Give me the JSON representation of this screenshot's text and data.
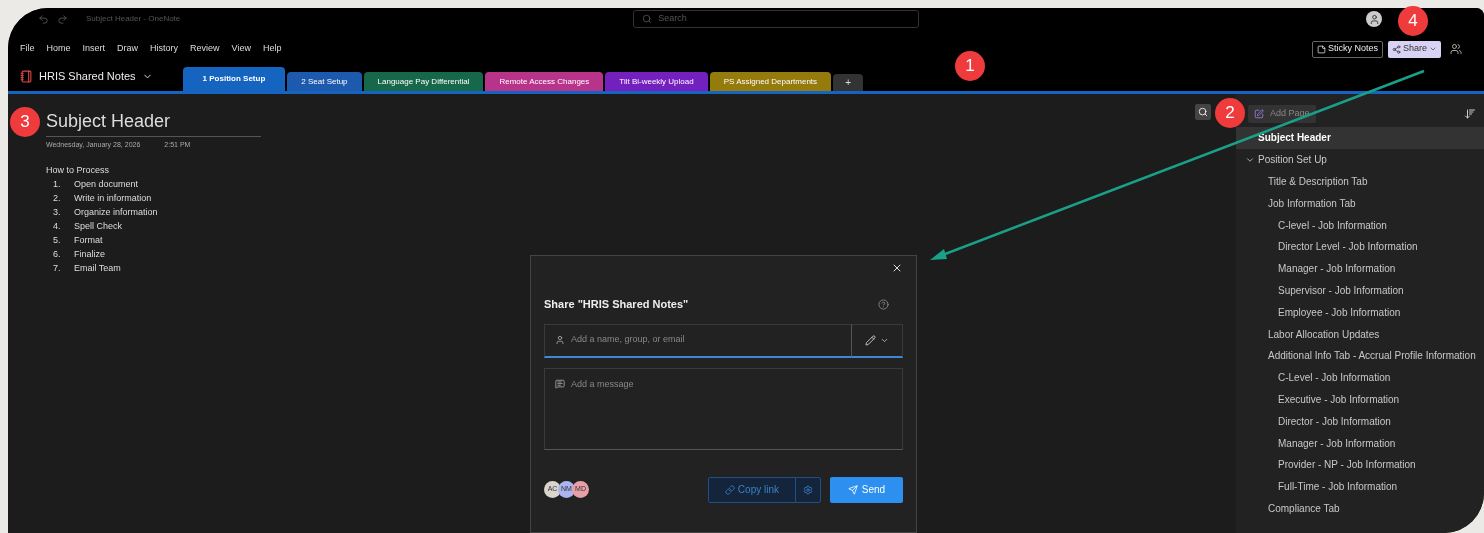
{
  "window": {
    "title": "Subject Header - OneNote",
    "search": {
      "placeholder": "Search"
    }
  },
  "menu": [
    "File",
    "Home",
    "Insert",
    "Draw",
    "History",
    "Review",
    "View",
    "Help"
  ],
  "toolbar_buttons": [
    {
      "kind": "sticky",
      "label": "Sticky Notes"
    },
    {
      "kind": "share",
      "label": "Share"
    }
  ],
  "notebook": {
    "name": "HRIS Shared Notes"
  },
  "sections": [
    {
      "label": "1 Position Setup",
      "color": "#1565c0",
      "selected": true
    },
    {
      "label": "2 Seat Setup",
      "color": "#1d59ad",
      "selected": false
    },
    {
      "label": "Language Pay Differential",
      "color": "#17684a",
      "selected": false
    },
    {
      "label": "Remote Access Changes",
      "color": "#b8348a",
      "selected": false
    },
    {
      "label": "Tilt Bi-weekly Upload",
      "color": "#7420bf",
      "selected": false
    },
    {
      "label": "PS Assigned Departments",
      "color": "#957a0c",
      "selected": false
    }
  ],
  "add_section": "+",
  "page": {
    "title": "Subject Header",
    "date": "Wednesday, January 28, 2026",
    "time": "2:51 PM",
    "heading": "How to Process",
    "steps": [
      {
        "n": "1.",
        "text": "Open document"
      },
      {
        "n": "2.",
        "text": "Write in information"
      },
      {
        "n": "3.",
        "text": "Organize information"
      },
      {
        "n": "4.",
        "text": "Spell Check"
      },
      {
        "n": "5.",
        "text": "Format"
      },
      {
        "n": "6.",
        "text": "Finalize"
      },
      {
        "n": "7.",
        "text": "Email Team"
      }
    ]
  },
  "page_list": {
    "add_page": "Add Page",
    "pages": [
      {
        "label": "Subject Header",
        "selected": true
      },
      {
        "label": "Position Set Up",
        "selected": false,
        "expanded": true,
        "children": [
          {
            "label": "Title & Description Tab",
            "selected": false
          },
          {
            "label": "Job Information Tab",
            "selected": false,
            "children": [
              {
                "label": "C-level - Job Information",
                "selected": false
              },
              {
                "label": "Director Level - Job Information",
                "selected": false
              },
              {
                "label": "Manager - Job Information",
                "selected": false
              },
              {
                "label": "Supervisor - Job Information",
                "selected": false
              },
              {
                "label": "Employee - Job Information",
                "selected": false
              }
            ]
          },
          {
            "label": "Labor Allocation Updates",
            "selected": false
          },
          {
            "label": "Additional Info Tab - Accrual Profile Information",
            "selected": false,
            "children": [
              {
                "label": "C-Level - Job Information",
                "selected": false
              },
              {
                "label": "Executive - Job Information",
                "selected": false
              },
              {
                "label": "Director - Job Information",
                "selected": false
              },
              {
                "label": "Manager - Job Information",
                "selected": false
              },
              {
                "label": "Provider - NP - Job Information",
                "selected": false
              },
              {
                "label": "Full-Time - Job Information",
                "selected": false
              }
            ]
          },
          {
            "label": "Compliance Tab",
            "selected": false
          }
        ]
      }
    ]
  },
  "share_dialog": {
    "title": "Share \"HRIS Shared Notes\"",
    "recipient": {
      "placeholder": "Add a name, group, or email"
    },
    "message": {
      "placeholder": "Add a message"
    },
    "avatars": [
      {
        "initials": "AC",
        "color": "#d9d4cc"
      },
      {
        "initials": "NM",
        "color": "#a9b4f0"
      },
      {
        "initials": "MD",
        "color": "#e8a0a8"
      }
    ],
    "copy_link": "Copy link",
    "send": "Send"
  },
  "annotations": [
    {
      "label": "1"
    },
    {
      "label": "2"
    },
    {
      "label": "3"
    },
    {
      "label": "4"
    }
  ]
}
